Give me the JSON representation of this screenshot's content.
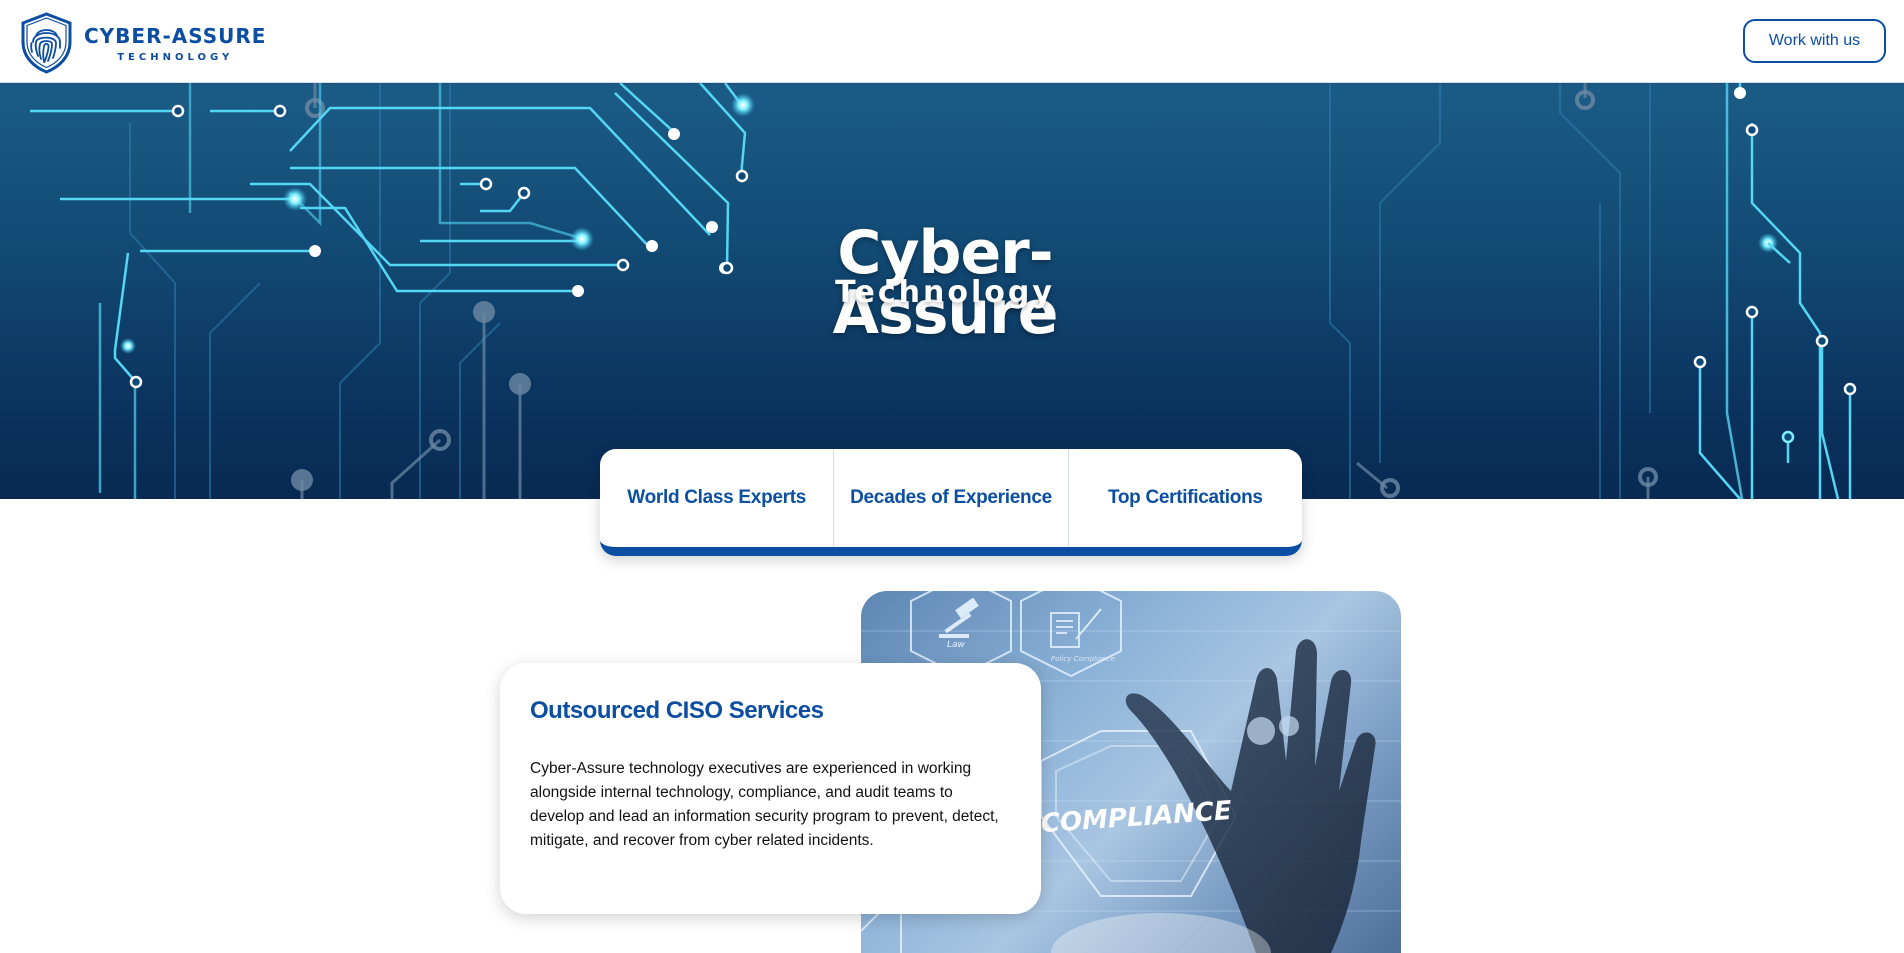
{
  "header": {
    "logo": {
      "name": "CYBER-ASSURE",
      "sub": "TECHNOLOGY"
    },
    "cta_label": "Work with us"
  },
  "hero": {
    "title": "Cyber-Assure",
    "subtitle": "Technology"
  },
  "features": [
    {
      "label": "World Class Experts"
    },
    {
      "label": "Decades of Experience"
    },
    {
      "label": "Top Certifications"
    }
  ],
  "service": {
    "title": "Outsourced CISO Services",
    "description": "Cyber-Assure technology executives are experienced in working alongside internal technology, compliance, and audit teams to develop and lead an information security program to prevent, detect, mitigate, and recover from cyber related incidents.",
    "image_overlay_text": "COMPLIANCE",
    "image_icon_labels": [
      "Law",
      "Policy Compliance"
    ]
  },
  "colors": {
    "brand_blue": "#0b4ea2",
    "hero_top": "#1b5c86",
    "hero_bottom": "#082a52",
    "circuit_glow": "#5fe6ff"
  },
  "icons": [
    "fingerprint-shield-icon",
    "gavel-icon",
    "document-icon",
    "gear-icon"
  ]
}
